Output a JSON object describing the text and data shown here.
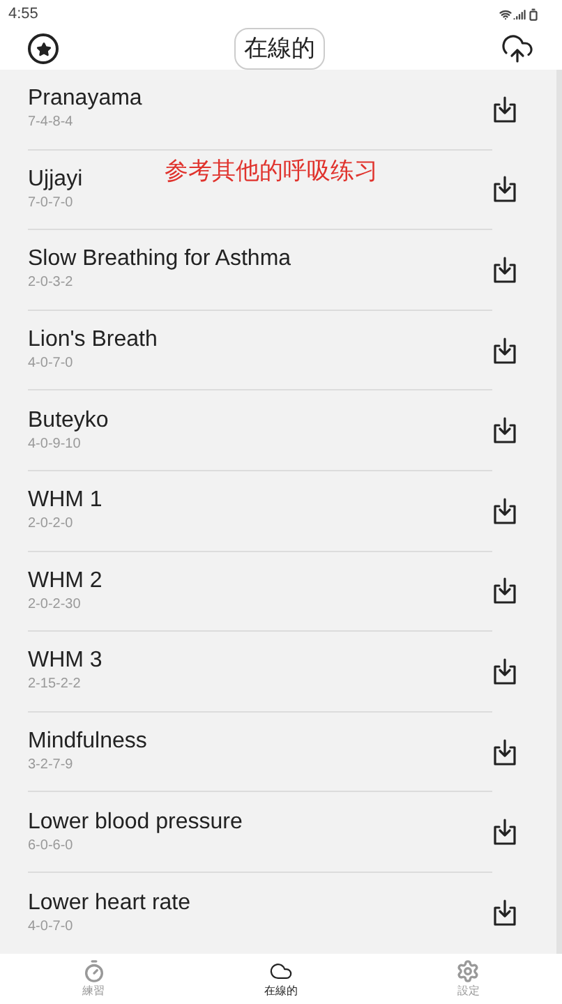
{
  "status_bar": {
    "time": "4:55"
  },
  "header": {
    "title": "在線的"
  },
  "annotation": "参考其他的呼吸练习",
  "exercises": [
    {
      "name": "Pranayama",
      "pattern": "7-4-8-4"
    },
    {
      "name": "Ujjayi",
      "pattern": "7-0-7-0"
    },
    {
      "name": "Slow Breathing for Asthma",
      "pattern": "2-0-3-2"
    },
    {
      "name": "Lion's Breath",
      "pattern": "4-0-7-0"
    },
    {
      "name": "Buteyko",
      "pattern": "4-0-9-10"
    },
    {
      "name": "WHM 1",
      "pattern": "2-0-2-0"
    },
    {
      "name": "WHM 2",
      "pattern": "2-0-2-30"
    },
    {
      "name": "WHM 3",
      "pattern": "2-15-2-2"
    },
    {
      "name": "Mindfulness",
      "pattern": "3-2-7-9"
    },
    {
      "name": "Lower blood pressure",
      "pattern": "6-0-6-0"
    },
    {
      "name": "Lower heart rate",
      "pattern": "4-0-7-0"
    }
  ],
  "nav": [
    {
      "kind": "timer",
      "label": "練習",
      "selected": false
    },
    {
      "kind": "cloud",
      "label": "在線的",
      "selected": true
    },
    {
      "kind": "settings",
      "label": "設定",
      "selected": false
    }
  ]
}
